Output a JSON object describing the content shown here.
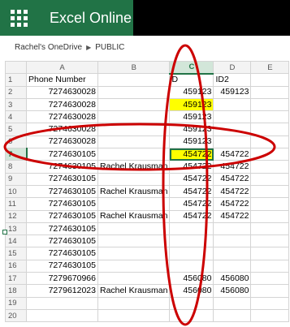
{
  "app": {
    "title": "Excel Online",
    "launcher_icon": "app-launcher-waffle-icon"
  },
  "breadcrumb": {
    "owner": "Rachel's OneDrive",
    "separator_icon": "chevron-right-icon",
    "folder": "PUBLIC"
  },
  "sheet": {
    "columns": [
      "A",
      "B",
      "C",
      "D",
      "E"
    ],
    "active_column": "C",
    "active_row": "7",
    "rows": [
      {
        "n": "1",
        "a": "Phone Number",
        "b": "",
        "c": "D",
        "d": "ID2",
        "e": ""
      },
      {
        "n": "2",
        "a": "7274630028",
        "b": "",
        "c": "459123",
        "d": "459123",
        "e": ""
      },
      {
        "n": "3",
        "a": "7274630028",
        "b": "",
        "c": "459123",
        "d": "",
        "e": "",
        "c_fill": "yellow"
      },
      {
        "n": "4",
        "a": "7274630028",
        "b": "",
        "c": "459123",
        "d": "",
        "e": ""
      },
      {
        "n": "5",
        "a": "7274630028",
        "b": "",
        "c": "459123",
        "d": "",
        "e": ""
      },
      {
        "n": "6",
        "a": "7274630028",
        "b": "",
        "c": "459123",
        "d": "",
        "e": ""
      },
      {
        "n": "7",
        "a": "7274630105",
        "b": "",
        "c": "454722",
        "d": "454722",
        "e": "",
        "c_fill": "yellow",
        "selected": true
      },
      {
        "n": "8",
        "a": "7274630105",
        "b": "Rachel Krausman",
        "c": "454722",
        "d": "454722",
        "e": ""
      },
      {
        "n": "9",
        "a": "7274630105",
        "b": "",
        "c": "454722",
        "d": "454722",
        "e": ""
      },
      {
        "n": "10",
        "a": "7274630105",
        "b": "Rachel Krausman",
        "c": "454722",
        "d": "454722",
        "e": ""
      },
      {
        "n": "11",
        "a": "7274630105",
        "b": "",
        "c": "454722",
        "d": "454722",
        "e": ""
      },
      {
        "n": "12",
        "a": "7274630105",
        "b": "Rachel Krausman",
        "c": "454722",
        "d": "454722",
        "e": ""
      },
      {
        "n": "13",
        "a": "7274630105",
        "b": "",
        "c": "",
        "d": "",
        "e": ""
      },
      {
        "n": "14",
        "a": "7274630105",
        "b": "",
        "c": "",
        "d": "",
        "e": ""
      },
      {
        "n": "15",
        "a": "7274630105",
        "b": "",
        "c": "",
        "d": "",
        "e": ""
      },
      {
        "n": "16",
        "a": "7274630105",
        "b": "",
        "c": "",
        "d": "",
        "e": ""
      },
      {
        "n": "17",
        "a": "7279670966",
        "b": "",
        "c": "456080",
        "d": "456080",
        "e": ""
      },
      {
        "n": "18",
        "a": "7279612023",
        "b": "Rachel Krausman",
        "c": "456080",
        "d": "456080",
        "e": ""
      },
      {
        "n": "19",
        "a": "",
        "b": "",
        "c": "",
        "d": "",
        "e": ""
      },
      {
        "n": "20",
        "a": "",
        "b": "",
        "c": "",
        "d": "",
        "e": ""
      }
    ]
  },
  "colors": {
    "brand": "#217346",
    "appbar": "#000000",
    "highlight": "#ffff00",
    "annotation": "#cc0000"
  }
}
